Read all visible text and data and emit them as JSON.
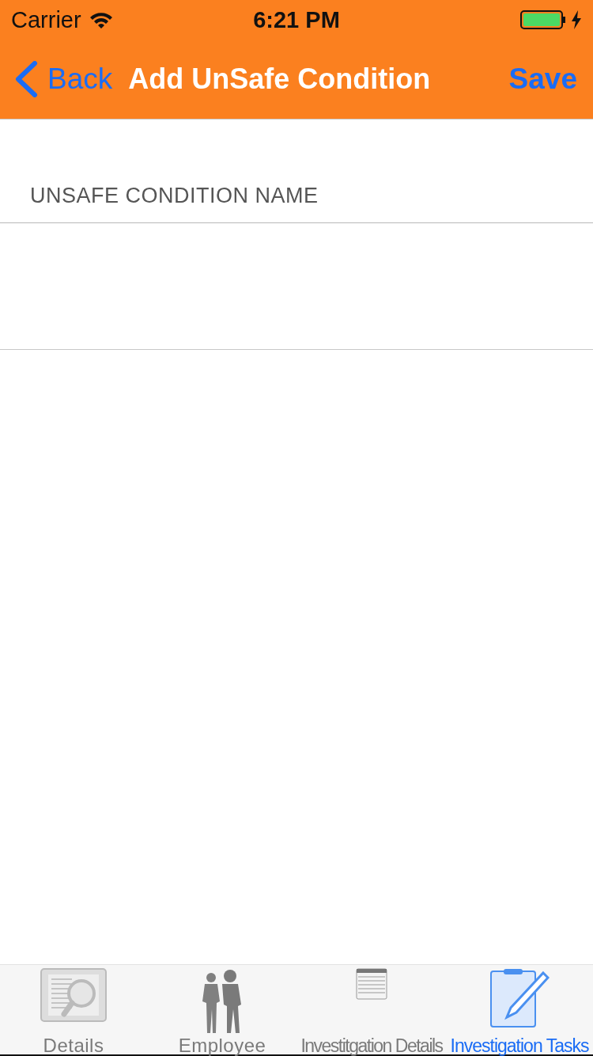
{
  "status_bar": {
    "carrier": "Carrier",
    "time": "6:21 PM"
  },
  "nav_bar": {
    "back": "Back",
    "title": "Add UnSafe Condition",
    "action": "Save"
  },
  "form": {
    "section_label": "UNSAFE CONDITION NAME"
  },
  "tab_bar": [
    {
      "kind": "book",
      "label": "Details",
      "selected": false
    },
    {
      "kind": "people",
      "label": "Employee",
      "selected": false
    },
    {
      "kind": "list",
      "label": "Investitgation Details",
      "selected": false
    },
    {
      "kind": "clipboard",
      "label": "Investigation Tasks",
      "selected": true
    }
  ]
}
